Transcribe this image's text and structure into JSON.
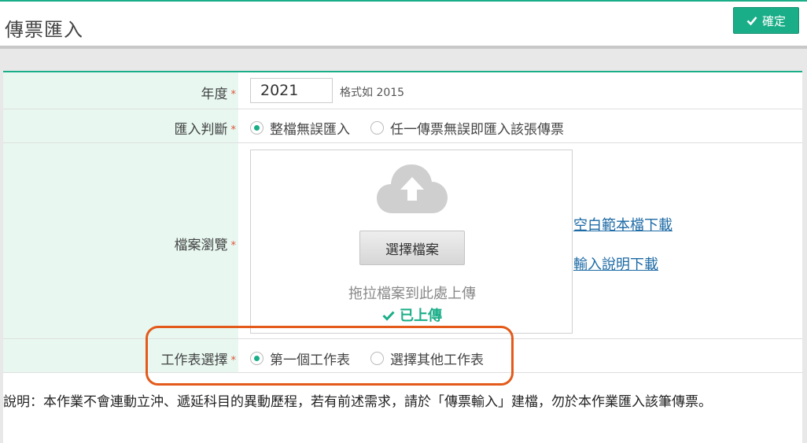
{
  "header": {
    "title": "傳票匯入",
    "confirm_label": "確定"
  },
  "form": {
    "year": {
      "label": "年度",
      "value": "2021",
      "hint": "格式如 2015"
    },
    "import_mode": {
      "label": "匯入判斷",
      "options": [
        "整檔無誤匯入",
        "任一傳票無誤即匯入該張傳票"
      ],
      "selected": "整檔無誤匯入"
    },
    "file_browse": {
      "label": "檔案瀏覽",
      "choose_button": "選擇檔案",
      "drop_text": "拖拉檔案到此處上傳",
      "uploaded_text": "已上傳",
      "links": [
        "空白範本檔下載",
        "輸入說明下載"
      ]
    },
    "sheet_select": {
      "label": "工作表選擇",
      "options": [
        "第一個工作表",
        "選擇其他工作表"
      ],
      "selected": "第一個工作表"
    }
  },
  "note": "說明：本作業不會連動立沖、遞延科目的異動歷程，若有前述需求，請於「傳票輸入」建檔，勿於本作業匯入該筆傳票。",
  "required_mark": "*",
  "colors": {
    "accent": "#1aae88",
    "highlight": "#e35a1a",
    "link": "#1d6aa5"
  },
  "icons": [
    "check-icon",
    "cloud-upload-icon"
  ]
}
